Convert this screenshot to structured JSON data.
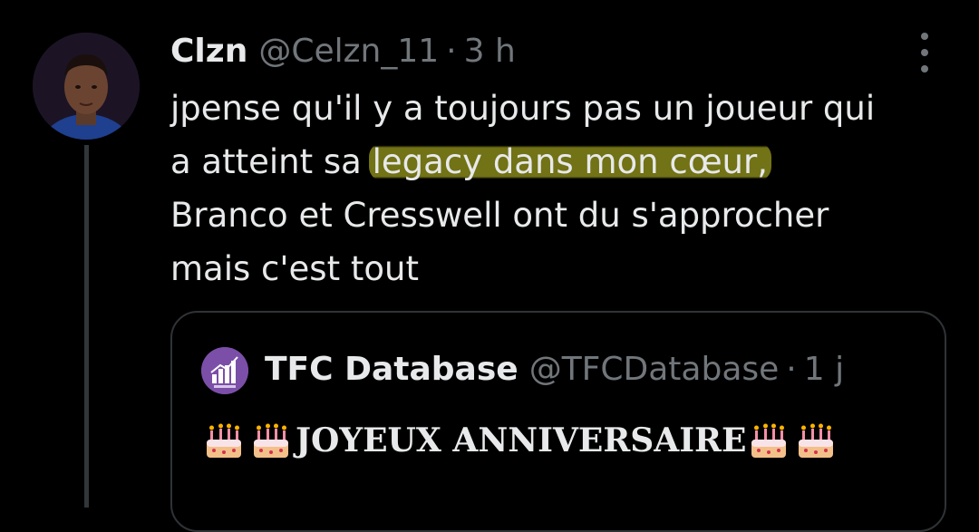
{
  "tweet": {
    "author": {
      "display_name": "Clzn",
      "handle": "@Celzn_11",
      "separator": "·",
      "time": "3 h",
      "avatar": "avatar"
    },
    "more_icon": "more-vertical-icon",
    "text_before": "jpense qu'il y a toujours pas un joueur qui\na atteint sa ",
    "text_highlighted": "legacy dans mon cœur,",
    "text_after": "\nBranco et Cresswell ont du s'approcher\nmais c'est tout",
    "highlight_color": "#7e7e18"
  },
  "quote": {
    "author": {
      "display_name": "TFC Database",
      "handle": "@TFCDatabase",
      "separator": "·",
      "time": "1 j",
      "avatar": "tfc-database-logo"
    },
    "text": "JOYEUX ANNIVERSAIRE",
    "emoji": "birthday-cake-icon"
  },
  "colors": {
    "background": "#000000",
    "primary_text": "#e7e9ea",
    "secondary_text": "#71767b",
    "border": "#2f3336",
    "thread_line": "#333639",
    "quote_avatar": "#7b4fa8"
  }
}
